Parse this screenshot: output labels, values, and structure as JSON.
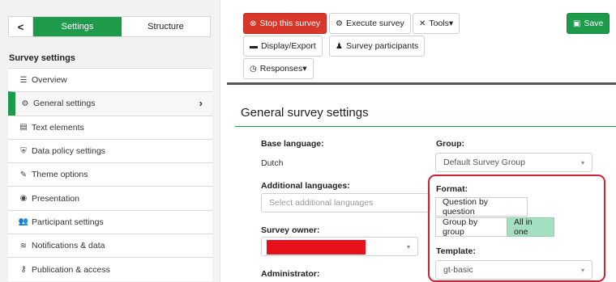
{
  "sidebar": {
    "back_label": "<",
    "tabs": [
      {
        "label": "Settings"
      },
      {
        "label": "Structure"
      }
    ],
    "heading": "Survey settings",
    "items": [
      {
        "icon": "list-icon",
        "glyph": "☰",
        "label": "Overview"
      },
      {
        "icon": "gears-icon",
        "glyph": "⚙",
        "label": "General settings"
      },
      {
        "icon": "file-text-icon",
        "glyph": "▤",
        "label": "Text elements"
      },
      {
        "icon": "shield-icon",
        "glyph": "⛨",
        "label": "Data policy settings"
      },
      {
        "icon": "brush-icon",
        "glyph": "✎",
        "label": "Theme options"
      },
      {
        "icon": "eye-slash-icon",
        "glyph": "◉",
        "label": "Presentation"
      },
      {
        "icon": "users-icon",
        "glyph": "👥",
        "label": "Participant settings"
      },
      {
        "icon": "rss-icon",
        "glyph": "≋",
        "label": "Notifications & data"
      },
      {
        "icon": "key-icon",
        "glyph": "⚷",
        "label": "Publication & access"
      }
    ],
    "chevron": "›"
  },
  "toolbar": {
    "stop": {
      "glyph": "⊗",
      "label": "Stop this survey"
    },
    "execute": {
      "glyph": "⚙",
      "label": "Execute survey"
    },
    "tools": {
      "glyph": "✕",
      "label": "Tools▾"
    },
    "save": {
      "glyph": "▣",
      "label": "Save"
    },
    "display": {
      "glyph": "▬",
      "label": "Display/Export"
    },
    "participants": {
      "glyph": "♟",
      "label": "Survey participants"
    },
    "responses": {
      "glyph": "◷",
      "label": "Responses▾"
    }
  },
  "main": {
    "title": "General survey settings",
    "base_language": {
      "label": "Base language:",
      "value": "Dutch"
    },
    "additional_languages": {
      "label": "Additional languages:",
      "placeholder": "Select additional languages"
    },
    "survey_owner": {
      "label": "Survey owner:"
    },
    "administrator": {
      "label": "Administrator:"
    },
    "group": {
      "label": "Group:",
      "value": "Default Survey Group"
    },
    "format": {
      "label": "Format:",
      "options": [
        "Question by question",
        "Group by group",
        "All in one"
      ],
      "selected": "All in one"
    },
    "template": {
      "label": "Template:",
      "value": "gt-basic"
    }
  },
  "colors": {
    "accent_green": "#1e9a4b",
    "stop_red": "#d9362b",
    "highlight_red": "#cc2233",
    "selected_format": "#a4dfc1"
  }
}
